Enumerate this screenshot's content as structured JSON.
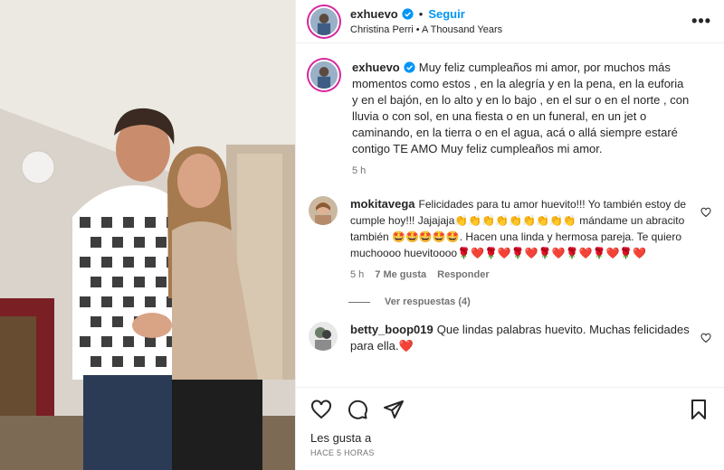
{
  "post": {
    "username": "exhuevo",
    "dot": "•",
    "follow_label": "Seguir",
    "song": "Christina Perri • A Thousand Years",
    "more_icon": "more-horizontal-icon"
  },
  "caption": {
    "username": "exhuevo",
    "text": "Muy feliz cumpleaños mi amor, por muchos más momentos como estos , en la alegría y en la pena, en la euforia y en el bajón, en lo alto y en lo bajo , en el sur o en el norte , con lluvia o con sol, en una fiesta o en un funeral, en un jet o caminando, en la tierra o en el agua, acá o allá siempre estaré contigo TE AMO Muy feliz cumpleaños mi amor.",
    "time": "5 h"
  },
  "comments": [
    {
      "username": "mokitavega",
      "text": "Felicidades para tu amor huevito!!! Yo también estoy de cumple hoy!!! Jajajaja👏👏👏👏👏👏👏👏👏 mándame un abracito también 🤩🤩🤩🤩🤩. Hacen una linda y hermosa pareja. Te quiero muchoooo huevitoooo🌹❤️🌹❤️🌹❤️🌹❤️🌹❤️🌹❤️🌹❤️",
      "time": "5 h",
      "likes": "7 Me gusta",
      "reply_label": "Responder",
      "view_replies": "Ver respuestas (4)"
    },
    {
      "username": "betty_boop019",
      "text": "Que lindas palabras huevito. Muchas felicidades para ella.❤️"
    }
  ],
  "footer": {
    "likes_text": "Les gusta a",
    "timestamp": "HACE 5 HORAS"
  },
  "colors": {
    "accent": "#0095f6",
    "verified": "#0095f6",
    "secondary_text": "#737373"
  }
}
